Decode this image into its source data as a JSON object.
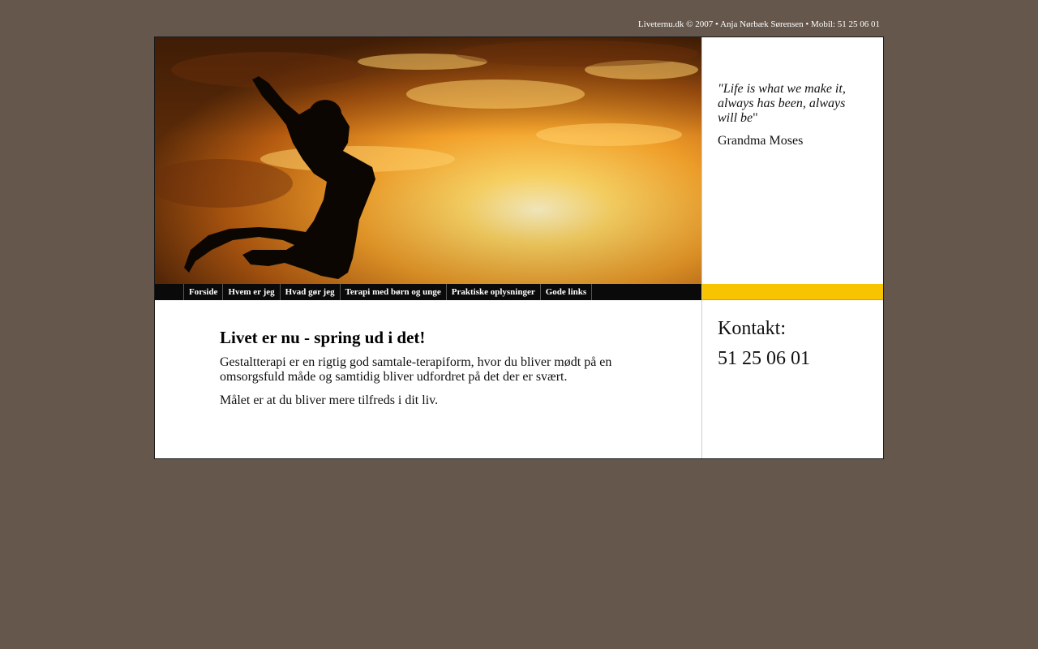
{
  "header": {
    "topline": "Liveternu.dk © 2007 • Anja Nørbæk Sørensen • Mobil: 51 25 06 01"
  },
  "hero": {
    "image": "sunset-jumping-silhouette"
  },
  "quote": {
    "text": "\"Life is what we make it, always has been, always will be",
    "close": "\"",
    "author": "Grandma Moses"
  },
  "nav": {
    "items": [
      {
        "label": "Forside"
      },
      {
        "label": "Hvem er jeg"
      },
      {
        "label": "Hvad gør jeg"
      },
      {
        "label": "Terapi med børn og unge"
      },
      {
        "label": "Praktiske oplysninger"
      },
      {
        "label": "Gode links"
      }
    ]
  },
  "main": {
    "title": "Livet er nu - spring ud i det!",
    "paragraph1": "Gestaltterapi er en rigtig god samtale-terapiform, hvor du bliver mødt på en omsorgsfuld måde og samtidig bliver udfordret på det der er svært.",
    "paragraph2": "Målet er at du bliver mere tilfreds i dit liv."
  },
  "contact": {
    "label": "Kontakt:",
    "phone": "51 25 06 01"
  },
  "colors": {
    "background": "#65574c",
    "accent_bar": "#f8c400",
    "nav_bg": "#0a0a0a"
  }
}
